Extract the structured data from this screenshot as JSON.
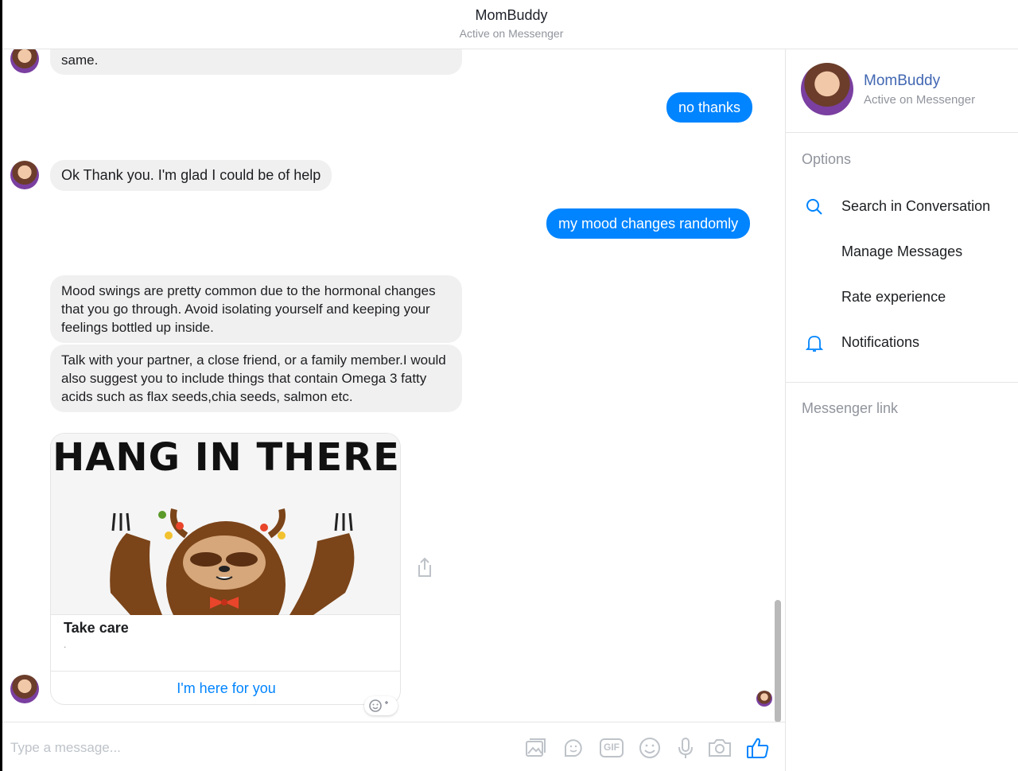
{
  "header": {
    "title": "MomBuddy",
    "status": "Active on Messenger"
  },
  "messages": {
    "partial_in": "same.",
    "out_1": "no thanks",
    "in_1": "Ok Thank you. I'm glad I could be of help",
    "out_2": "my mood changes randomly",
    "in_2": "Mood swings are pretty common due to the hormonal changes that you go through. Avoid isolating yourself and keeping your feelings bottled up inside.",
    "in_3": "Talk with your partner, a close friend, or a family member.I would also suggest you to include things that contain Omega 3 fatty acids such as flax seeds,chia seeds, salmon etc.",
    "card": {
      "image_text": "HANG IN THERE",
      "title": "Take care",
      "subtitle": ".",
      "button": "I'm here for you"
    }
  },
  "composer": {
    "placeholder": "Type a message...",
    "tools": [
      "photo-icon",
      "sticker-icon",
      "gif-icon",
      "emoji-icon",
      "microphone-icon",
      "camera-icon",
      "thumbs-up-icon"
    ],
    "gif_label": "GIF"
  },
  "panel": {
    "name": "MomBuddy",
    "status": "Active on Messenger",
    "options_heading": "Options",
    "options": [
      {
        "label": "Search in Conversation",
        "icon": "search-icon"
      },
      {
        "label": "Manage Messages",
        "icon": ""
      },
      {
        "label": "Rate experience",
        "icon": ""
      },
      {
        "label": "Notifications",
        "icon": "bell-icon"
      }
    ],
    "link_heading": "Messenger link"
  },
  "colors": {
    "accent": "#0084ff",
    "incoming_bubble": "#f1f0f0",
    "link": "#4267b2"
  }
}
